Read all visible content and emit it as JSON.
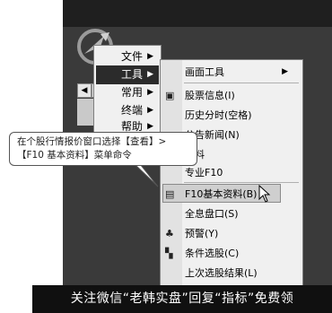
{
  "menu1": {
    "items": [
      {
        "label": "文件",
        "has_submenu": true
      },
      {
        "label": "工具",
        "has_submenu": true,
        "selected": true
      },
      {
        "label": "常用",
        "has_submenu": true
      },
      {
        "label": "终端",
        "has_submenu": true
      },
      {
        "label": "帮助",
        "has_submenu": true
      }
    ]
  },
  "menu2": {
    "items": [
      {
        "label": "画面工具",
        "has_submenu": true
      },
      {
        "label": "股票信息(I)",
        "icon": "stock-info-icon"
      },
      {
        "label": "历史分时(空格)"
      },
      {
        "label": "公告新闻(N)"
      },
      {
        "label": "资料"
      },
      {
        "label": "专业F10"
      },
      {
        "label": "F10基本资料(B)",
        "icon": "f10-icon",
        "highlighted": true
      },
      {
        "label": "全息盘口(S)"
      },
      {
        "label": "预警(Y)",
        "icon": "bell-icon"
      },
      {
        "label": "条件选股(C)",
        "icon": "binoculars-icon"
      },
      {
        "label": "上次选股结果(L)"
      }
    ]
  },
  "tabs": [
    "◀",
    "▶"
  ],
  "callout": {
    "line1": "在个股行情报价窗口选择【查看】>",
    "line2": "【F10 基本资料】菜单命令"
  },
  "footer": {
    "text": "关注微信“老韩实盘”回复“指标”免费领"
  },
  "colors": {
    "app_bg": "#3a3a3a",
    "menu_bg": "#f0f0f0",
    "selection": "#2b2b2b",
    "footer_bg": "#101010"
  }
}
